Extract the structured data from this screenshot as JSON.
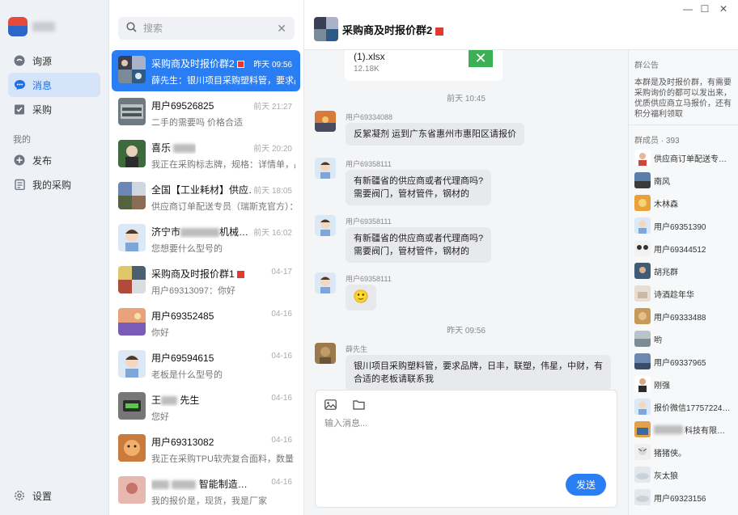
{
  "nav": {
    "items": [
      {
        "label": "询源",
        "icon": "inquiry-icon"
      },
      {
        "label": "消息",
        "icon": "message-icon"
      },
      {
        "label": "采购",
        "icon": "purchase-icon"
      }
    ],
    "section_mine": "我的",
    "mine_items": [
      {
        "label": "发布",
        "icon": "publish-icon"
      },
      {
        "label": "我的采购",
        "icon": "my-purchase-icon"
      }
    ],
    "settings_label": "设置"
  },
  "search": {
    "placeholder": "搜索"
  },
  "conversations": [
    {
      "name": "采购商及时报价群2",
      "time": "昨天 09:56",
      "preview": "薛先生：银川项目采购塑料管，要求品牌",
      "active": true
    },
    {
      "name": "用户69526825",
      "time": "前天 21:27",
      "preview": "二手的需要吗 价格合适"
    },
    {
      "name": "喜乐",
      "time": "前天 20:20",
      "preview": "我正在采购标志牌，规格：详情单，品牌"
    },
    {
      "name": "全国【工业耗材】供应…",
      "time": "前天 18:05",
      "preview": "供应商订单配送专员（瑞斯克官方）："
    },
    {
      "name_prefix": "济宁市",
      "name_suffix": "机械…",
      "time": "前天 16:02",
      "preview": "您想要什么型号的"
    },
    {
      "name": "采购商及时报价群1",
      "time": "04-17",
      "preview": "用户69313097：你好"
    },
    {
      "name": "用户69352485",
      "time": "04-16",
      "preview": "你好"
    },
    {
      "name": "用户69594615",
      "time": "04-16",
      "preview": "老板是什么型号的"
    },
    {
      "name_prefix": "王",
      "name_suffix": "先生",
      "time": "04-16",
      "preview": "您好"
    },
    {
      "name": "用户69313082",
      "time": "04-16",
      "preview": "我正在采购TPU软壳复合面料，数量：80"
    },
    {
      "name_suffix": "智能制造…",
      "time": "04-16",
      "preview": "我的报价是，现货，我是厂家"
    }
  ],
  "chat": {
    "title": "采购商及时报价群2",
    "file": {
      "name": "(1).xlsx",
      "size": "12.18K"
    },
    "messages": [
      {
        "type": "time",
        "text": "前天 10:45"
      },
      {
        "type": "msg",
        "sender": "用户69334088",
        "lines": [
          "反絮凝剂 运到广东省惠州市惠阳区请报价"
        ]
      },
      {
        "type": "msg",
        "sender": "用户69358111",
        "lines": [
          "有新疆省的供应商或者代理商吗?",
          "需要阀门，管材管件，钢材的"
        ]
      },
      {
        "type": "msg",
        "sender": "用户69358111",
        "lines": [
          "有新疆省的供应商或者代理商吗?",
          "需要阀门，管材管件，钢材的"
        ]
      },
      {
        "type": "msg",
        "sender": "用户69358111",
        "emoji": "🙂"
      },
      {
        "type": "time",
        "text": "昨天 09:56"
      },
      {
        "type": "msg",
        "sender": "薛先生",
        "lines": [
          "银川项目采购塑料管，要求品牌，日丰，联塑，伟星，中财，有",
          "合适的老板请联系我"
        ]
      }
    ],
    "composer": {
      "placeholder": "输入消息...",
      "send_label": "发送"
    }
  },
  "group": {
    "notice_header": "群公告",
    "notice": "本群是及时报价群，有需要采购询价的都可以发出来，优质供应商立马报价，还有积分福利领取",
    "members_header": "群成员 · 393",
    "members": [
      "供应商订单配送专…",
      "南风",
      "木林森",
      "用户69351390",
      "用户69344512",
      "胡兆群",
      "诗酒趁年华",
      "用户69333488",
      "哟",
      "用户69337965",
      "刚强",
      "报价微信17757224…",
      "科技有限…",
      "猪猪侠。",
      "灰太狼",
      "用户69323156"
    ]
  },
  "colors": {
    "accent": "#2a7ef3",
    "nav_bg": "#eef1f6",
    "chat_bg": "#f4f5f7"
  }
}
